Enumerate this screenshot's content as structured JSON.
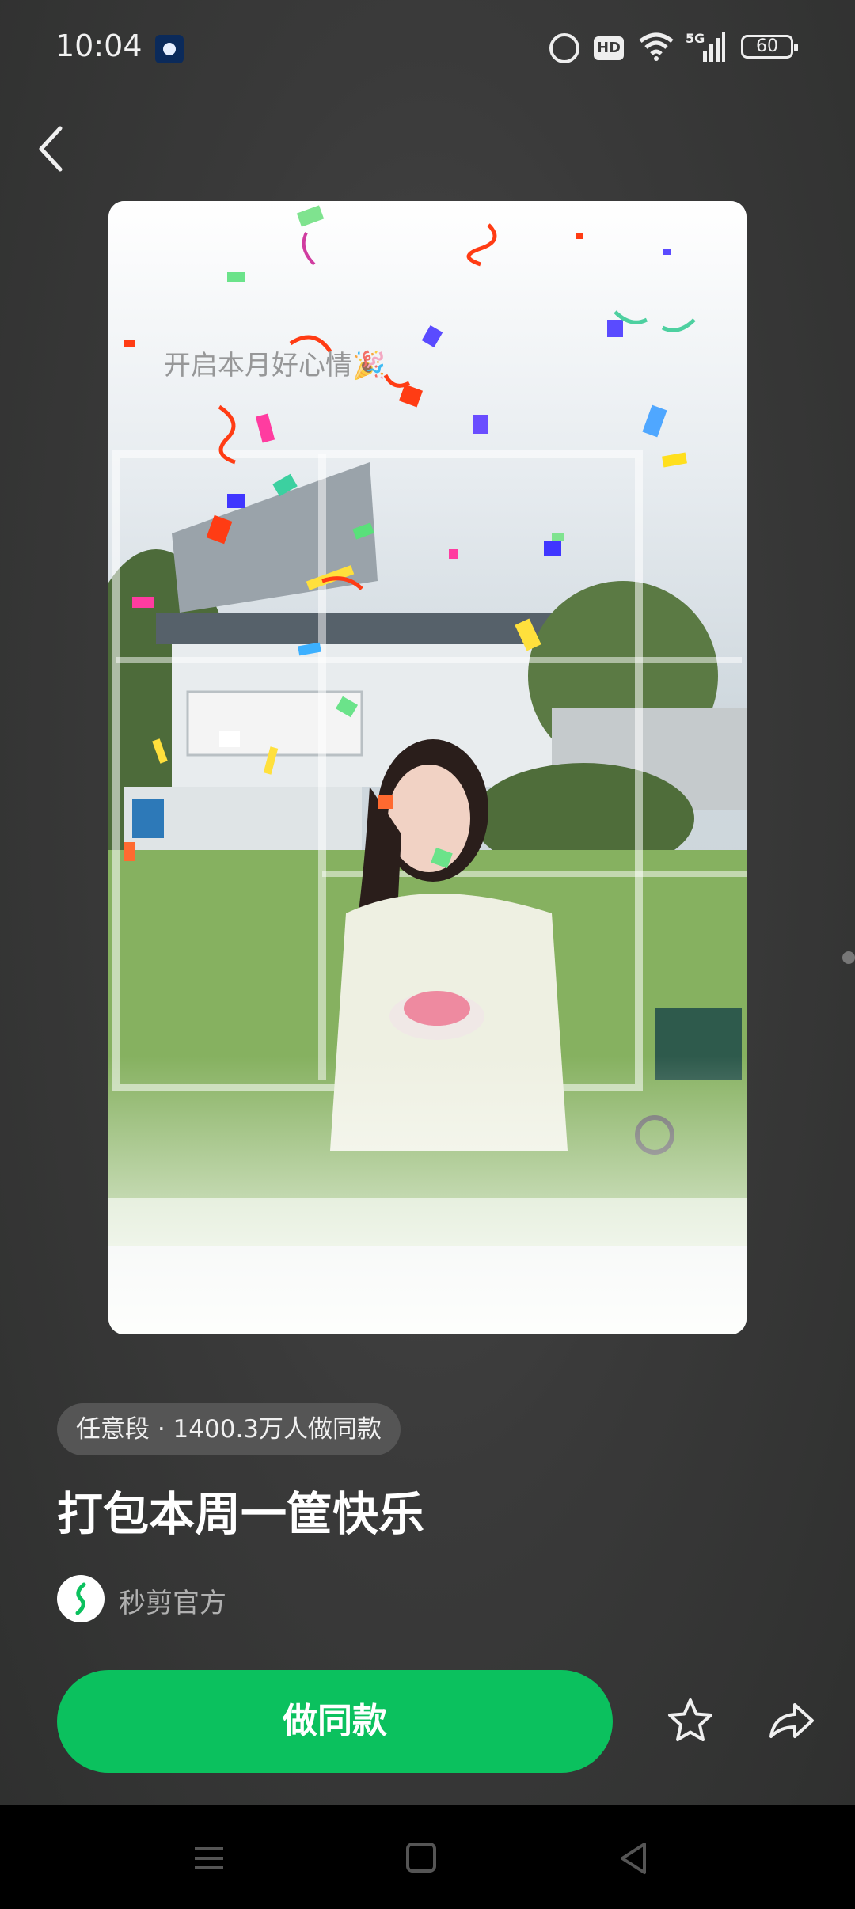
{
  "status_bar": {
    "time": "10:04",
    "battery": "60",
    "icons": [
      "app-badge-icon",
      "alarm-icon",
      "hd-icon",
      "wifi-icon",
      "signal-5g-icon",
      "battery-icon"
    ]
  },
  "preview": {
    "overlay_caption": "开启本月好心情🎉"
  },
  "template": {
    "meta": "任意段 · 1400.3万人做同款",
    "title": "打包本周一筐快乐",
    "author": "秒剪官方"
  },
  "actions": {
    "primary_label": "做同款",
    "icons": [
      "star-icon",
      "share-icon"
    ]
  },
  "colors": {
    "accent": "#0bc15e",
    "background": "#3d3d3d"
  }
}
